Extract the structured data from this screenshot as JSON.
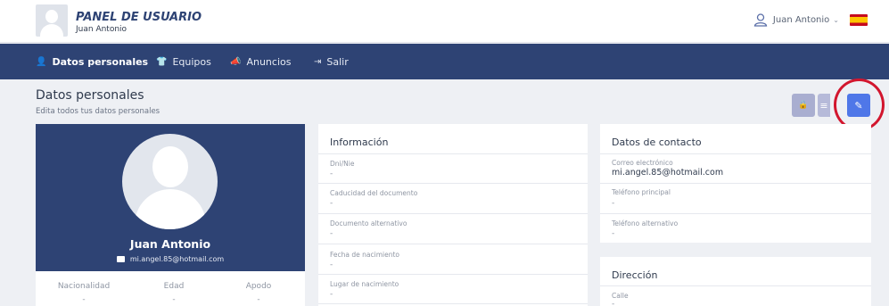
{
  "header": {
    "title": "PANEL DE USUARIO",
    "subtitle": "Juan Antonio",
    "user_name": "Juan Antonio",
    "chevron": "⌄",
    "flag": "es-flag-icon"
  },
  "nav": {
    "items": [
      {
        "label": "Datos personales",
        "icon": "user-icon",
        "glyph": "👤"
      },
      {
        "label": "Equipos",
        "icon": "shirt-icon",
        "glyph": "👕"
      },
      {
        "label": "Anuncios",
        "icon": "megaphone-icon",
        "glyph": "📣"
      },
      {
        "label": "Salir",
        "icon": "sign-out-icon",
        "glyph": "⇥"
      }
    ]
  },
  "page": {
    "title": "Datos personales",
    "subtitle": "Edita todos tus datos personales"
  },
  "toolbar": {
    "lock_glyph": "🔒",
    "list_glyph": "≡",
    "edit_glyph": "✎"
  },
  "profile": {
    "name": "Juan Antonio",
    "email": "mi.angel.85@hotmail.com",
    "stats": [
      {
        "label": "Nacionalidad",
        "value": "-"
      },
      {
        "label": "Edad",
        "value": "-"
      },
      {
        "label": "Apodo",
        "value": "-"
      }
    ]
  },
  "informacion": {
    "title": "Información",
    "fields": [
      {
        "label": "Dni/Nie",
        "value": "-"
      },
      {
        "label": "Caducidad del documento",
        "value": "-"
      },
      {
        "label": "Documento alternativo",
        "value": "-"
      },
      {
        "label": "Fecha de nacimiento",
        "value": "-"
      },
      {
        "label": "Lugar de nacimiento",
        "value": "-"
      }
    ]
  },
  "contacto": {
    "title": "Datos de contacto",
    "fields": [
      {
        "label": "Correo electrónico",
        "value": "mi.angel.85@hotmail.com"
      },
      {
        "label": "Teléfono principal",
        "value": "-"
      },
      {
        "label": "Teléfono alternativo",
        "value": "-"
      }
    ]
  },
  "direccion": {
    "title": "Dirección",
    "fields": [
      {
        "label": "Calle",
        "value": "-"
      }
    ]
  },
  "colors": {
    "navy": "#2e4374",
    "accent_blue": "#4f77e8",
    "annotation_red": "#d2162e"
  }
}
